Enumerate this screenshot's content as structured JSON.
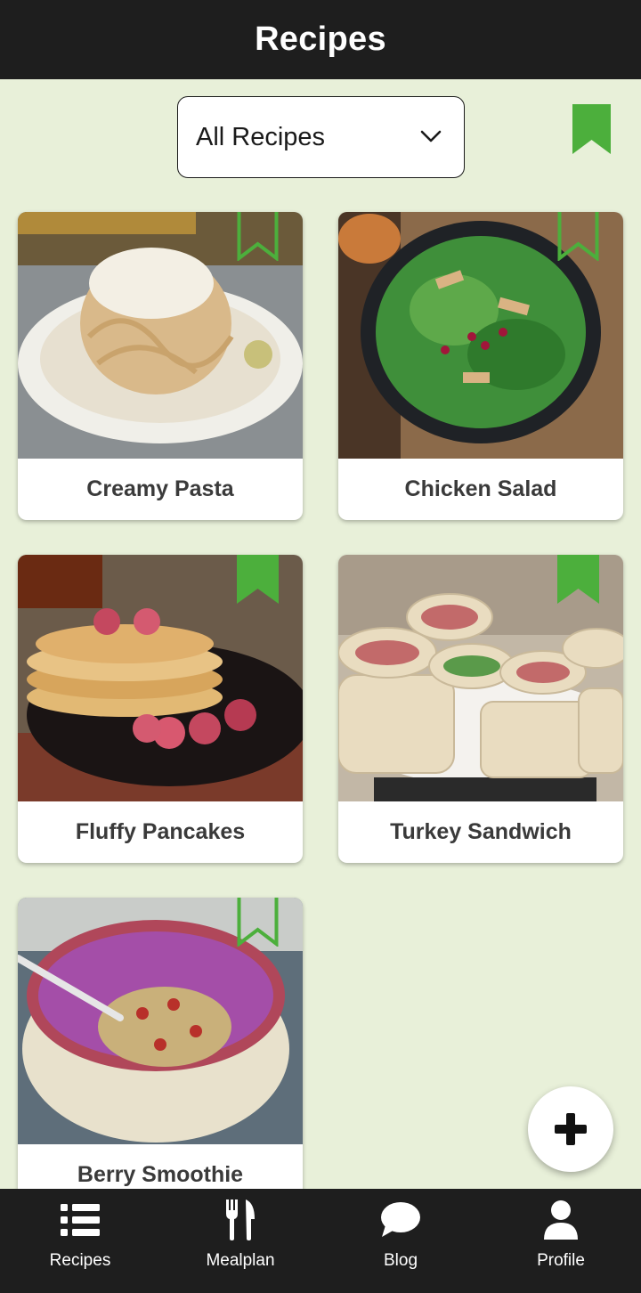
{
  "header": {
    "title": "Recipes"
  },
  "filter": {
    "selected": "All Recipes",
    "icon": "chevron-down-icon"
  },
  "saved_toggle": {
    "icon": "bookmark-filled-icon",
    "color": "#4caf3c"
  },
  "recipes": [
    {
      "title": "Creamy Pasta",
      "bookmarked": false
    },
    {
      "title": "Chicken Salad",
      "bookmarked": false
    },
    {
      "title": "Fluffy Pancakes",
      "bookmarked": true
    },
    {
      "title": "Turkey Sandwich",
      "bookmarked": true
    },
    {
      "title": "Berry Smoothie",
      "bookmarked": false
    }
  ],
  "fab": {
    "icon": "plus-icon"
  },
  "tabs": [
    {
      "label": "Recipes",
      "icon": "list-icon"
    },
    {
      "label": "Mealplan",
      "icon": "fork-knife-icon"
    },
    {
      "label": "Blog",
      "icon": "chat-bubble-icon"
    },
    {
      "label": "Profile",
      "icon": "person-icon"
    }
  ],
  "colors": {
    "accent": "#4caf3c",
    "bar": "#1e1e1e",
    "background": "#e8f0d9"
  }
}
